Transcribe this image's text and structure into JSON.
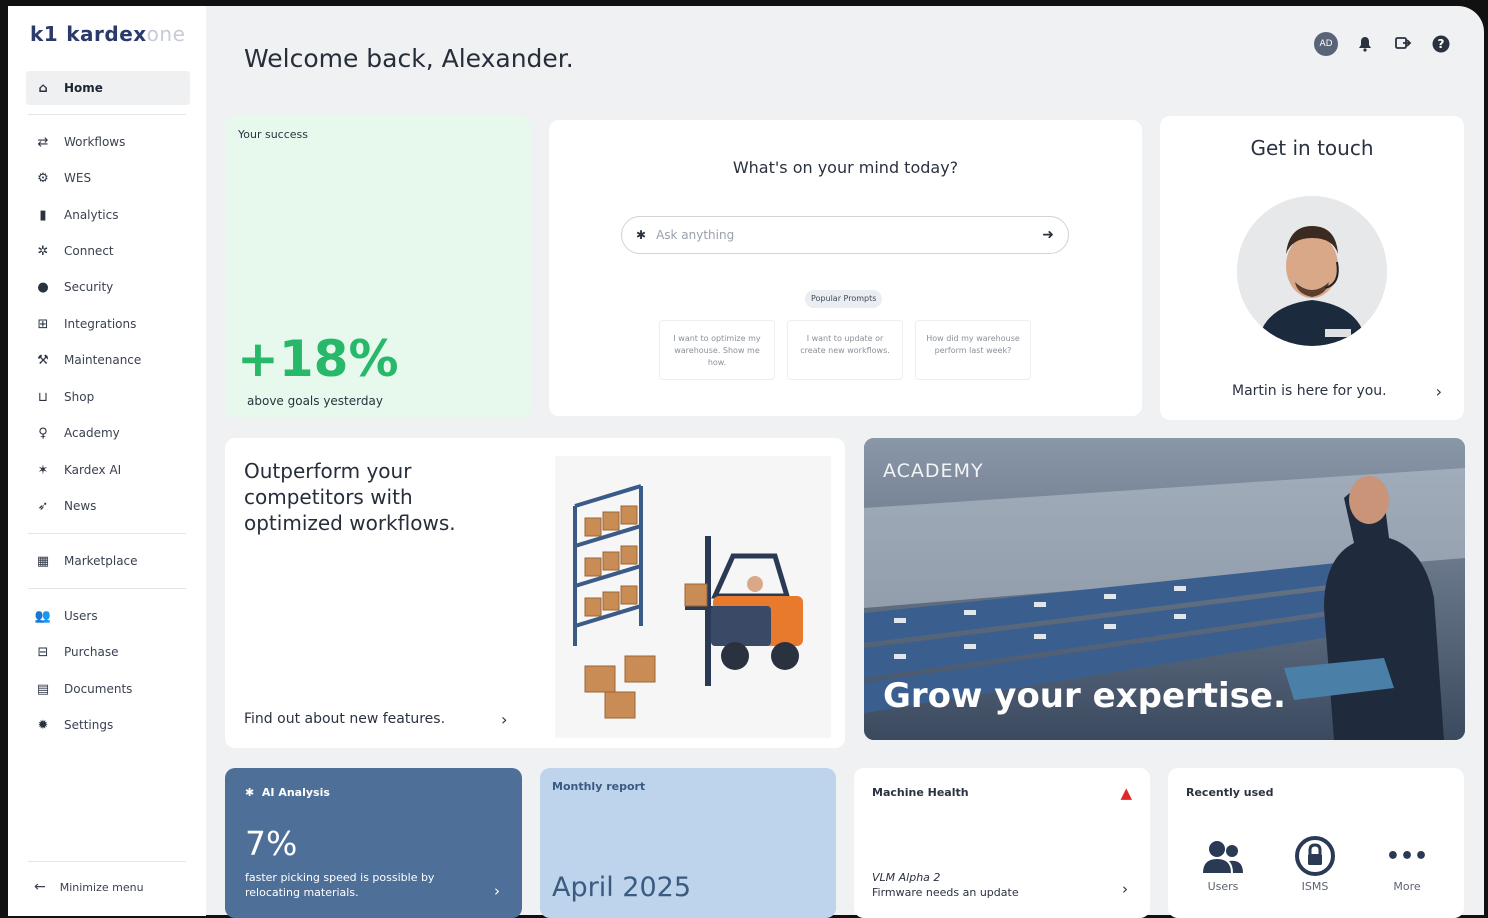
{
  "app": {
    "logo_k1": "k1",
    "logo_kardex": "kardex",
    "logo_one": "one"
  },
  "header": {
    "welcome": "Welcome back, Alexander.",
    "avatar_initials": "AD"
  },
  "sidebar": {
    "items": [
      {
        "label": "Home",
        "icon": "home-icon"
      },
      {
        "label": "Workflows",
        "icon": "arrows-icon"
      },
      {
        "label": "WES",
        "icon": "wes-icon"
      },
      {
        "label": "Analytics",
        "icon": "bar-chart-icon"
      },
      {
        "label": "Connect",
        "icon": "network-icon"
      },
      {
        "label": "Security",
        "icon": "security-icon"
      },
      {
        "label": "Integrations",
        "icon": "integrations-icon"
      },
      {
        "label": "Maintenance",
        "icon": "wrench-icon"
      },
      {
        "label": "Shop",
        "icon": "cart-icon"
      },
      {
        "label": "Academy",
        "icon": "lightbulb-icon"
      },
      {
        "label": "Kardex AI",
        "icon": "sparkle-icon"
      },
      {
        "label": "News",
        "icon": "paper-plane-icon"
      },
      {
        "label": "Marketplace",
        "icon": "grid-icon"
      },
      {
        "label": "Users",
        "icon": "users-icon"
      },
      {
        "label": "Purchase",
        "icon": "purchase-icon"
      },
      {
        "label": "Documents",
        "icon": "documents-icon"
      },
      {
        "label": "Settings",
        "icon": "gear-icon"
      }
    ],
    "minimize_label": "Minimize menu"
  },
  "success": {
    "label": "Your success",
    "value": "+18%",
    "caption": "above goals yesterday"
  },
  "mind": {
    "question": "What's on your mind today?",
    "placeholder": "Ask anything",
    "popular_label": "Popular Prompts",
    "prompts": [
      "I want to optimize my warehouse. Show me how.",
      "I want to update or create new workflows.",
      "How did my warehouse perform last week?"
    ]
  },
  "touch": {
    "title": "Get in touch",
    "caption": "Martin is here for you."
  },
  "workflows": {
    "headline": "Outperform your competitors with optimized workflows.",
    "link": "Find out about new features."
  },
  "academy": {
    "tag": "ACADEMY",
    "headline": "Grow your expertise."
  },
  "ai_analysis": {
    "label": "AI Analysis",
    "value": "7%",
    "caption": "faster picking speed is possible by relocating materials."
  },
  "monthly_report": {
    "label": "Monthly report",
    "value": "April 2025"
  },
  "machine_health": {
    "label": "Machine Health",
    "machine": "VLM Alpha 2",
    "status": "Firmware needs an update"
  },
  "recently_used": {
    "label": "Recently used",
    "items": [
      "Users",
      "ISMS",
      "More"
    ]
  },
  "colors": {
    "success_bg": "#e7f9ec",
    "success_text": "#27b86a",
    "ai_bg": "#4d6f98",
    "report_bg": "#bdd4ec",
    "warning": "#e02828"
  }
}
